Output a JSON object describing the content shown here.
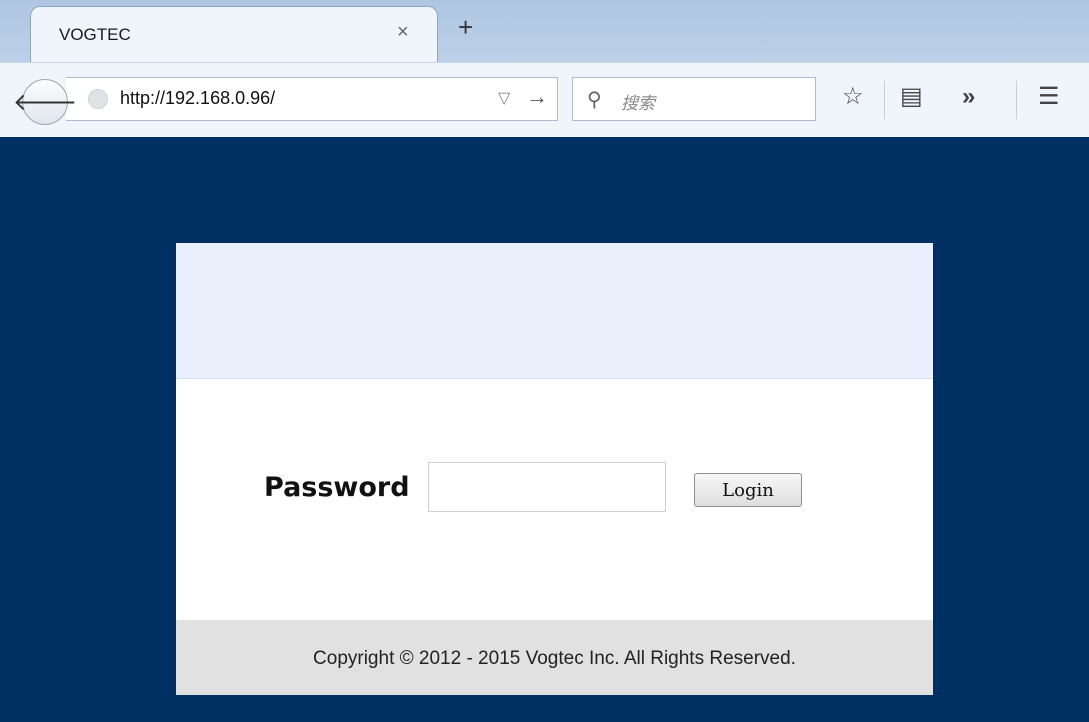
{
  "browser": {
    "tab": {
      "title": "VOGTEC",
      "close_glyph": "×"
    },
    "new_tab_glyph": "+",
    "url": "http://192.168.0.96/",
    "search": {
      "placeholder": "搜索"
    },
    "icons": [
      "back-icon",
      "globe-icon",
      "dropdown-icon",
      "go-icon",
      "search-icon",
      "star-icon",
      "reading-list-icon",
      "overflow-icon",
      "menu-icon"
    ]
  },
  "page": {
    "password_label": "Password",
    "password_value": "",
    "login_label": "Login",
    "copyright": "Copyright © 2012 - 2015 Vogtec Inc. All Rights Reserved."
  },
  "colors": {
    "page_background": "#002f63",
    "panel_header": "#e9f0fb",
    "footer": "#e1e1e1"
  }
}
